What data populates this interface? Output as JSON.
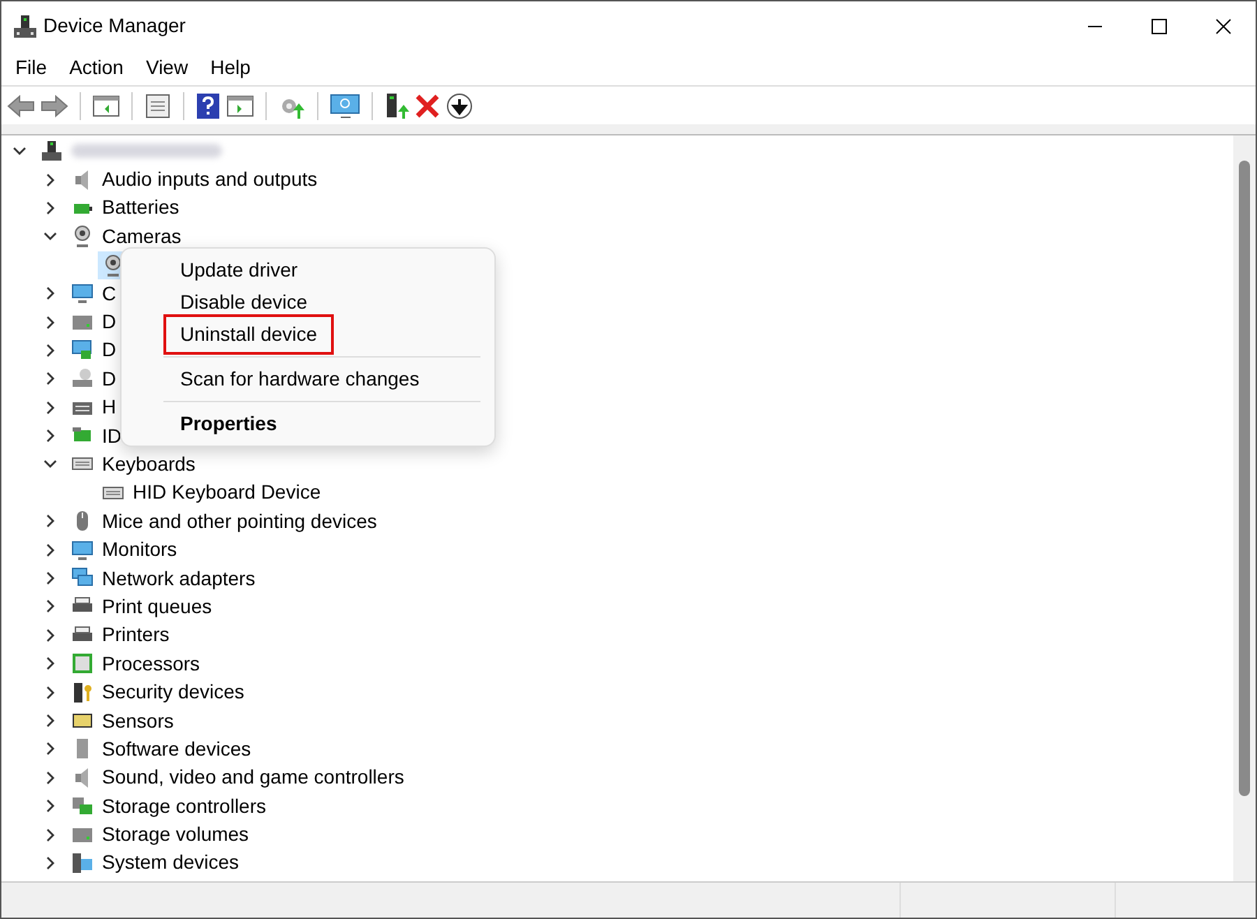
{
  "window": {
    "title": "Device Manager"
  },
  "menu_bar": [
    "File",
    "Action",
    "View",
    "Help"
  ],
  "tree": {
    "expanded": true,
    "children": [
      {
        "label": "Audio inputs and outputs",
        "expanded": false
      },
      {
        "label": "Batteries",
        "expanded": false
      },
      {
        "label": "Cameras",
        "expanded": true,
        "children": [
          {
            "selected": true
          }
        ]
      },
      {
        "label": "C",
        "expanded": false
      },
      {
        "label": "D",
        "expanded": false
      },
      {
        "label": "D",
        "expanded": false
      },
      {
        "label": "D",
        "expanded": false
      },
      {
        "label": "H",
        "expanded": false
      },
      {
        "label": "ID",
        "expanded": false
      },
      {
        "label": "Keyboards",
        "expanded": true,
        "children": [
          {
            "label": "HID Keyboard Device",
            "selected": false
          }
        ]
      },
      {
        "label": "Mice and other pointing devices",
        "expanded": false
      },
      {
        "label": "Monitors",
        "expanded": false
      },
      {
        "label": "Network adapters",
        "expanded": false
      },
      {
        "label": "Print queues",
        "expanded": false
      },
      {
        "label": "Printers",
        "expanded": false
      },
      {
        "label": "Processors",
        "expanded": false
      },
      {
        "label": "Security devices",
        "expanded": false
      },
      {
        "label": "Sensors",
        "expanded": false
      },
      {
        "label": "Software devices",
        "expanded": false
      },
      {
        "label": "Sound, video and game controllers",
        "expanded": false
      },
      {
        "label": "Storage controllers",
        "expanded": false
      },
      {
        "label": "Storage volumes",
        "expanded": false
      },
      {
        "label": "System devices",
        "expanded": false
      }
    ]
  },
  "context_menu": [
    {
      "label": "Update driver",
      "default": false,
      "outlined": false,
      "separator_after": false
    },
    {
      "label": "Disable device",
      "default": false,
      "outlined": false,
      "separator_after": false
    },
    {
      "label": "Uninstall device",
      "default": false,
      "outlined": true,
      "separator_after": true
    },
    {
      "label": "Scan for hardware changes",
      "default": false,
      "outlined": false,
      "separator_after": true
    },
    {
      "label": "Properties",
      "default": true,
      "outlined": false,
      "separator_after": false
    }
  ]
}
